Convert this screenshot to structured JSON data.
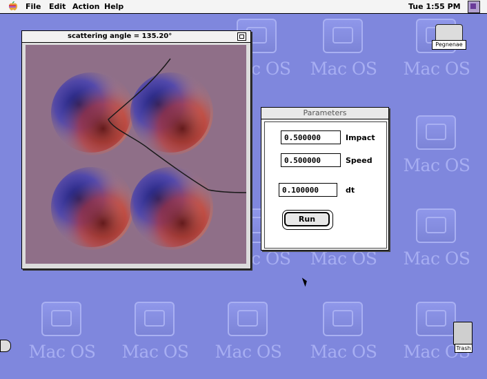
{
  "menubar": {
    "items": [
      "File",
      "Edit",
      "Action",
      "Help"
    ],
    "clock": "Tue 1:55 PM"
  },
  "desktop": {
    "pattern_text": "Mac OS",
    "hard_drive_label": "Pegnenae",
    "trash_label": "Trash"
  },
  "scatter_window": {
    "title": "scattering angle = 135.20°",
    "trajectory_color": "#1a1a1a"
  },
  "parameters_window": {
    "title": "Parameters",
    "fields": [
      {
        "value": "0.500000",
        "label": "Impact"
      },
      {
        "value": "0.500000",
        "label": "Speed"
      },
      {
        "value": "0.100000",
        "label": "dt"
      }
    ],
    "run_label": "Run"
  },
  "colors": {
    "desktop_bg": "#7f87dd",
    "desktop_pattern": "#a7aef2",
    "plot_bg": "#8f6f88"
  }
}
